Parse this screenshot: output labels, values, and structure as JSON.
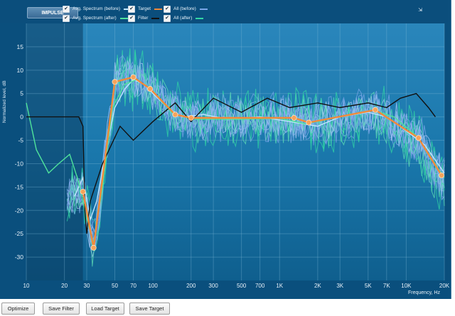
{
  "toolbar": {
    "impulse_label": "IMPULSE",
    "close_label": "⇲"
  },
  "legend": [
    {
      "label": "Avg. Spectrum (before)",
      "color": "#bfe6ff",
      "checked": true
    },
    {
      "label": "Target",
      "color": "#f28a3a",
      "checked": true
    },
    {
      "label": "All (before)",
      "color": "#7aa6e8",
      "checked": true
    },
    {
      "label": "Avg. Spectrum (after)",
      "color": "#4fe39b",
      "checked": true
    },
    {
      "label": "Filter",
      "color": "#111111",
      "checked": true
    },
    {
      "label": "All (after)",
      "color": "#32d8a4",
      "checked": true
    }
  ],
  "chart_data": {
    "type": "line",
    "ylabel": "Normalized level, dB",
    "xlabel": "Frequency, Hz",
    "x_scale": "log",
    "xlim": [
      10,
      20000
    ],
    "ylim": [
      -35,
      20
    ],
    "x_ticks": [
      {
        "value": 10,
        "label": "10"
      },
      {
        "value": 20,
        "label": "20"
      },
      {
        "value": 30,
        "label": "30"
      },
      {
        "value": 50,
        "label": "50"
      },
      {
        "value": 70,
        "label": "70"
      },
      {
        "value": 100,
        "label": "100"
      },
      {
        "value": 200,
        "label": "200"
      },
      {
        "value": 300,
        "label": "300"
      },
      {
        "value": 500,
        "label": "500"
      },
      {
        "value": 700,
        "label": "700"
      },
      {
        "value": 1000,
        "label": "1K"
      },
      {
        "value": 2000,
        "label": "2K"
      },
      {
        "value": 3000,
        "label": "3K"
      },
      {
        "value": 5000,
        "label": "5K"
      },
      {
        "value": 7000,
        "label": "7K"
      },
      {
        "value": 10000,
        "label": "10K"
      },
      {
        "value": 20000,
        "label": "20K"
      }
    ],
    "y_ticks": [
      {
        "value": 15,
        "label": "15"
      },
      {
        "value": 10,
        "label": "10"
      },
      {
        "value": 5,
        "label": "5"
      },
      {
        "value": 0,
        "label": "0"
      },
      {
        "value": -5,
        "label": "-5"
      },
      {
        "value": -10,
        "label": "-10"
      },
      {
        "value": -15,
        "label": "-15"
      },
      {
        "value": -20,
        "label": "-20"
      },
      {
        "value": -25,
        "label": "-25"
      },
      {
        "value": -30,
        "label": "-30"
      }
    ],
    "excluded_band_hz": [
      10,
      28
    ],
    "target_points": [
      [
        28,
        -16
      ],
      [
        34,
        -28
      ],
      [
        50,
        7.5
      ],
      [
        70,
        8.5
      ],
      [
        95,
        6
      ],
      [
        150,
        0.5
      ],
      [
        200,
        -0.2
      ],
      [
        1300,
        -0.2
      ],
      [
        1700,
        -1.2
      ],
      [
        5700,
        1.5
      ],
      [
        12500,
        -4.5
      ],
      [
        19000,
        -12.5
      ]
    ],
    "series": [
      {
        "name": "Avg. Spectrum (before)",
        "color": "#bfe6ff",
        "points": [
          [
            24,
            -17
          ],
          [
            28,
            -13
          ],
          [
            32,
            -22
          ],
          [
            36,
            -18
          ],
          [
            42,
            -8
          ],
          [
            50,
            2
          ],
          [
            60,
            6
          ],
          [
            70,
            8
          ],
          [
            85,
            7
          ],
          [
            100,
            5
          ],
          [
            130,
            2
          ],
          [
            170,
            0
          ],
          [
            250,
            0.5
          ],
          [
            400,
            -0.5
          ],
          [
            700,
            0
          ],
          [
            1200,
            -1
          ],
          [
            2000,
            -2
          ],
          [
            3000,
            0
          ],
          [
            5000,
            1
          ],
          [
            7000,
            0
          ],
          [
            10000,
            -3
          ],
          [
            14000,
            -6
          ],
          [
            20000,
            -12
          ]
        ]
      },
      {
        "name": "Avg. Spectrum (after)",
        "color": "#4fe39b",
        "points": [
          [
            10,
            3
          ],
          [
            12,
            -7
          ],
          [
            15,
            -12
          ],
          [
            18,
            -10
          ],
          [
            22,
            -8
          ],
          [
            26,
            -14
          ],
          [
            30,
            -22
          ],
          [
            34,
            -27
          ],
          [
            40,
            -15
          ],
          [
            48,
            2
          ],
          [
            60,
            7
          ],
          [
            75,
            8
          ],
          [
            95,
            6
          ],
          [
            140,
            1
          ],
          [
            200,
            -0.5
          ],
          [
            500,
            -0.5
          ],
          [
            1000,
            -0.3
          ],
          [
            1600,
            -1.5
          ],
          [
            3000,
            0
          ],
          [
            5500,
            1.5
          ],
          [
            8000,
            0
          ],
          [
            12000,
            -4
          ],
          [
            20000,
            -13
          ]
        ]
      },
      {
        "name": "Filter",
        "color": "#111111",
        "points": [
          [
            10,
            0
          ],
          [
            14,
            0
          ],
          [
            20,
            0
          ],
          [
            26,
            0
          ],
          [
            28,
            -2
          ],
          [
            29,
            -20
          ],
          [
            30,
            -25
          ],
          [
            32,
            -18
          ],
          [
            40,
            -10
          ],
          [
            55,
            -2
          ],
          [
            70,
            -5
          ],
          [
            100,
            -1
          ],
          [
            150,
            3
          ],
          [
            200,
            -1
          ],
          [
            300,
            4
          ],
          [
            500,
            1
          ],
          [
            800,
            4
          ],
          [
            1200,
            2
          ],
          [
            2000,
            3
          ],
          [
            3000,
            2
          ],
          [
            5000,
            3
          ],
          [
            7000,
            2
          ],
          [
            9000,
            4
          ],
          [
            12000,
            5
          ],
          [
            15000,
            2
          ],
          [
            17000,
            0
          ]
        ]
      }
    ]
  },
  "buttons": {
    "optimize": "Optimize",
    "save_filter": "Save Filter",
    "load_target": "Load Target",
    "save_target": "Save Target"
  }
}
